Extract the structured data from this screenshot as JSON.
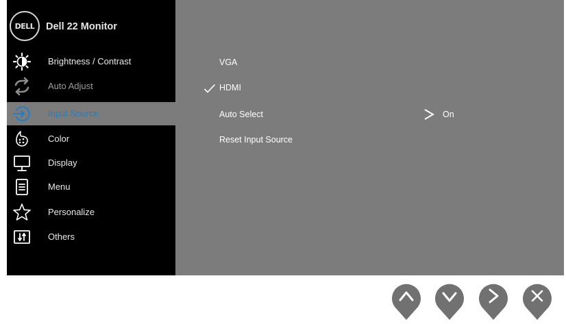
{
  "header": {
    "logo_text": "DELL",
    "title": "Dell 22 Monitor"
  },
  "menu": {
    "items": [
      {
        "label": "Brightness / Contrast",
        "icon": "brightness-contrast-icon",
        "state": "normal"
      },
      {
        "label": "Auto Adjust",
        "icon": "auto-adjust-icon",
        "state": "disabled"
      },
      {
        "label": "Input Source",
        "icon": "input-source-icon",
        "state": "selected"
      },
      {
        "label": "Color",
        "icon": "color-palette-icon",
        "state": "normal"
      },
      {
        "label": "Display",
        "icon": "display-monitor-icon",
        "state": "normal"
      },
      {
        "label": "Menu",
        "icon": "menu-document-icon",
        "state": "normal"
      },
      {
        "label": "Personalize",
        "icon": "star-icon",
        "state": "normal"
      },
      {
        "label": "Others",
        "icon": "others-icon",
        "state": "normal"
      }
    ]
  },
  "submenu": {
    "options": [
      {
        "label": "VGA",
        "checked": false
      },
      {
        "label": "HDMI",
        "checked": true
      },
      {
        "label": "Auto Select",
        "value": "On"
      },
      {
        "label": "Reset Input Source"
      }
    ]
  },
  "buttons": [
    {
      "name": "up-button",
      "icon": "chevron-up-icon"
    },
    {
      "name": "down-button",
      "icon": "chevron-down-icon"
    },
    {
      "name": "right-button",
      "icon": "chevron-right-icon"
    },
    {
      "name": "close-button",
      "icon": "close-icon"
    }
  ],
  "colors": {
    "sidebar_background": "#000000",
    "panel_background": "#7c7c7c",
    "selected_label": "#1d7fc5",
    "button": "#717171"
  }
}
